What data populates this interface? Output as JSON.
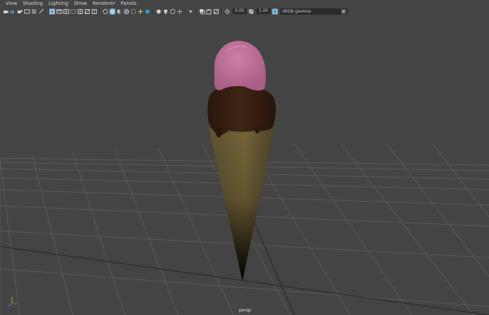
{
  "menu": {
    "items": [
      "View",
      "Shading",
      "Lighting",
      "Show",
      "Renderer",
      "Panels"
    ]
  },
  "toolbar": {
    "icons": [
      "select-camera-icon",
      "camera-attributes-icon",
      "bookmarks-icon",
      "image-plane-icon",
      "grid-toggle-icon",
      "safe-frame-icon",
      "field-chart-icon",
      "resolution-gate-icon",
      "gate-mask-icon",
      "film-gate-icon",
      "wireframe-icon",
      "smooth-shade-icon",
      "textured-icon",
      "lights-icon",
      "shadows-icon",
      "ambient-occlusion-icon",
      "motion-blur-icon",
      "isolate-select-icon",
      "xray-icon",
      "camera-depth-icon"
    ],
    "exposure_value": "0.00",
    "gamma_value": "1.00",
    "color_space": "sRGB gamma"
  },
  "viewport": {
    "camera_label": "persp",
    "background_color": "#444444",
    "grid_color": "#5a5a5a"
  },
  "colors": {
    "accent": "#5285a6",
    "ice_cream": "#c1729a",
    "chocolate": "#3a2012",
    "cone": "#6b5a34"
  }
}
